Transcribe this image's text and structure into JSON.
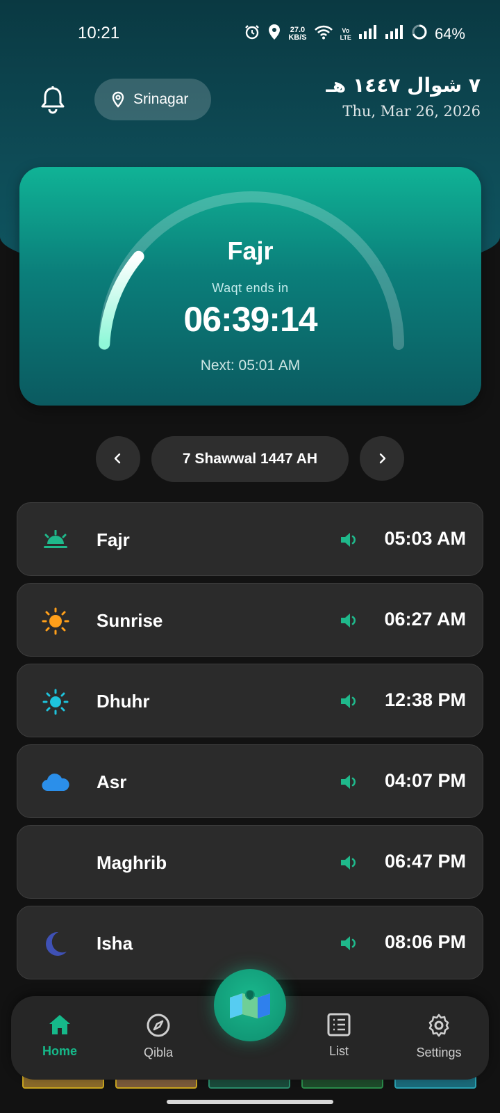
{
  "status_bar": {
    "time": "10:21",
    "net_speed_value": "27.0",
    "net_speed_unit": "KB/S",
    "volte_line1": "Vo",
    "volte_line2": "LTE",
    "battery": "64%"
  },
  "header": {
    "location": "Srinagar",
    "hijri_arabic": "٧ شوال ١٤٤٧ هـ",
    "gregorian_date": "Thu, Mar 26, 2026"
  },
  "countdown_card": {
    "current_prayer": "Fajr",
    "waqt_label": "Waqt ends in",
    "remaining": "06:39:14",
    "next_label": "Next: 05:01 AM",
    "progress_fraction": 0.2
  },
  "date_nav": {
    "hijri_date": "7 Shawwal 1447 AH"
  },
  "prayers": [
    {
      "name": "Fajr",
      "time": "05:03 AM",
      "icon": "sunrise-icon",
      "color": "#1fb98b"
    },
    {
      "name": "Sunrise",
      "time": "06:27 AM",
      "icon": "sun-icon",
      "color": "#ff9f1a"
    },
    {
      "name": "Dhuhr",
      "time": "12:38 PM",
      "icon": "sun-icon",
      "color": "#1ec3dc"
    },
    {
      "name": "Asr",
      "time": "04:07 PM",
      "icon": "cloud-icon",
      "color": "#2b8fea"
    },
    {
      "name": "Maghrib",
      "time": "06:47 PM",
      "icon": "crescent-icon",
      "color": "#f4511e"
    },
    {
      "name": "Isha",
      "time": "08:06 PM",
      "icon": "crescent-icon",
      "color": "#3f51b5"
    }
  ],
  "bottom_nav": {
    "home": "Home",
    "qibla": "Qibla",
    "list": "List",
    "settings": "Settings"
  },
  "colors": {
    "accent": "#16b98a",
    "card_top": "#10b396",
    "card_bottom": "#0b5a60"
  }
}
